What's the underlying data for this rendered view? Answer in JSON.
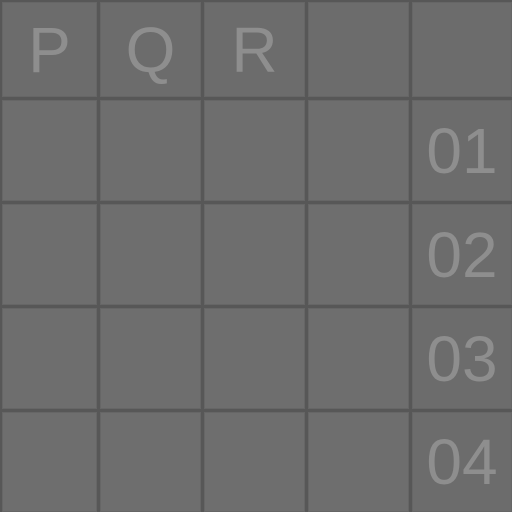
{
  "board": {
    "column_labels": [
      "P",
      "Q",
      "R",
      "",
      ""
    ],
    "row_labels": [
      "01",
      "02",
      "03",
      "04"
    ],
    "colors": {
      "background": "#575757",
      "cell": "#6e6e6e",
      "text": "#8e8e8e"
    }
  }
}
